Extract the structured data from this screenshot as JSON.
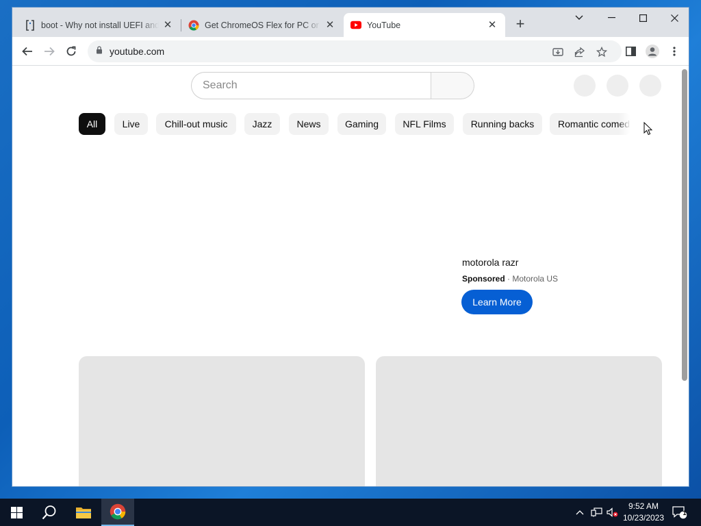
{
  "browser": {
    "tabs": [
      {
        "title": "boot - Why not install UEFI and l",
        "icon": "bracket-site-icon",
        "active": false
      },
      {
        "title": "Get ChromeOS Flex for PC or Mac",
        "icon": "chrome-icon",
        "active": false
      },
      {
        "title": "YouTube",
        "icon": "youtube-icon",
        "active": true
      }
    ],
    "new_tab_label": "+",
    "url": "youtube.com"
  },
  "youtube": {
    "search_placeholder": "Search",
    "chips": [
      "All",
      "Live",
      "Chill-out music",
      "Jazz",
      "News",
      "Gaming",
      "NFL Films",
      "Running backs",
      "Romantic comed"
    ],
    "ad": {
      "title": "motorola razr",
      "sponsored": "Sponsored",
      "separator": "·",
      "advertiser": "Motorola US",
      "cta": "Learn More"
    }
  },
  "colors": {
    "accent": "#065fd4",
    "chip_selected": "#0f0f0f",
    "chip_bg": "#f2f2f2",
    "taskbar": "#0b1526"
  },
  "taskbar": {
    "time": "9:52 AM",
    "date": "10/23/2023",
    "notification_count": "1"
  }
}
